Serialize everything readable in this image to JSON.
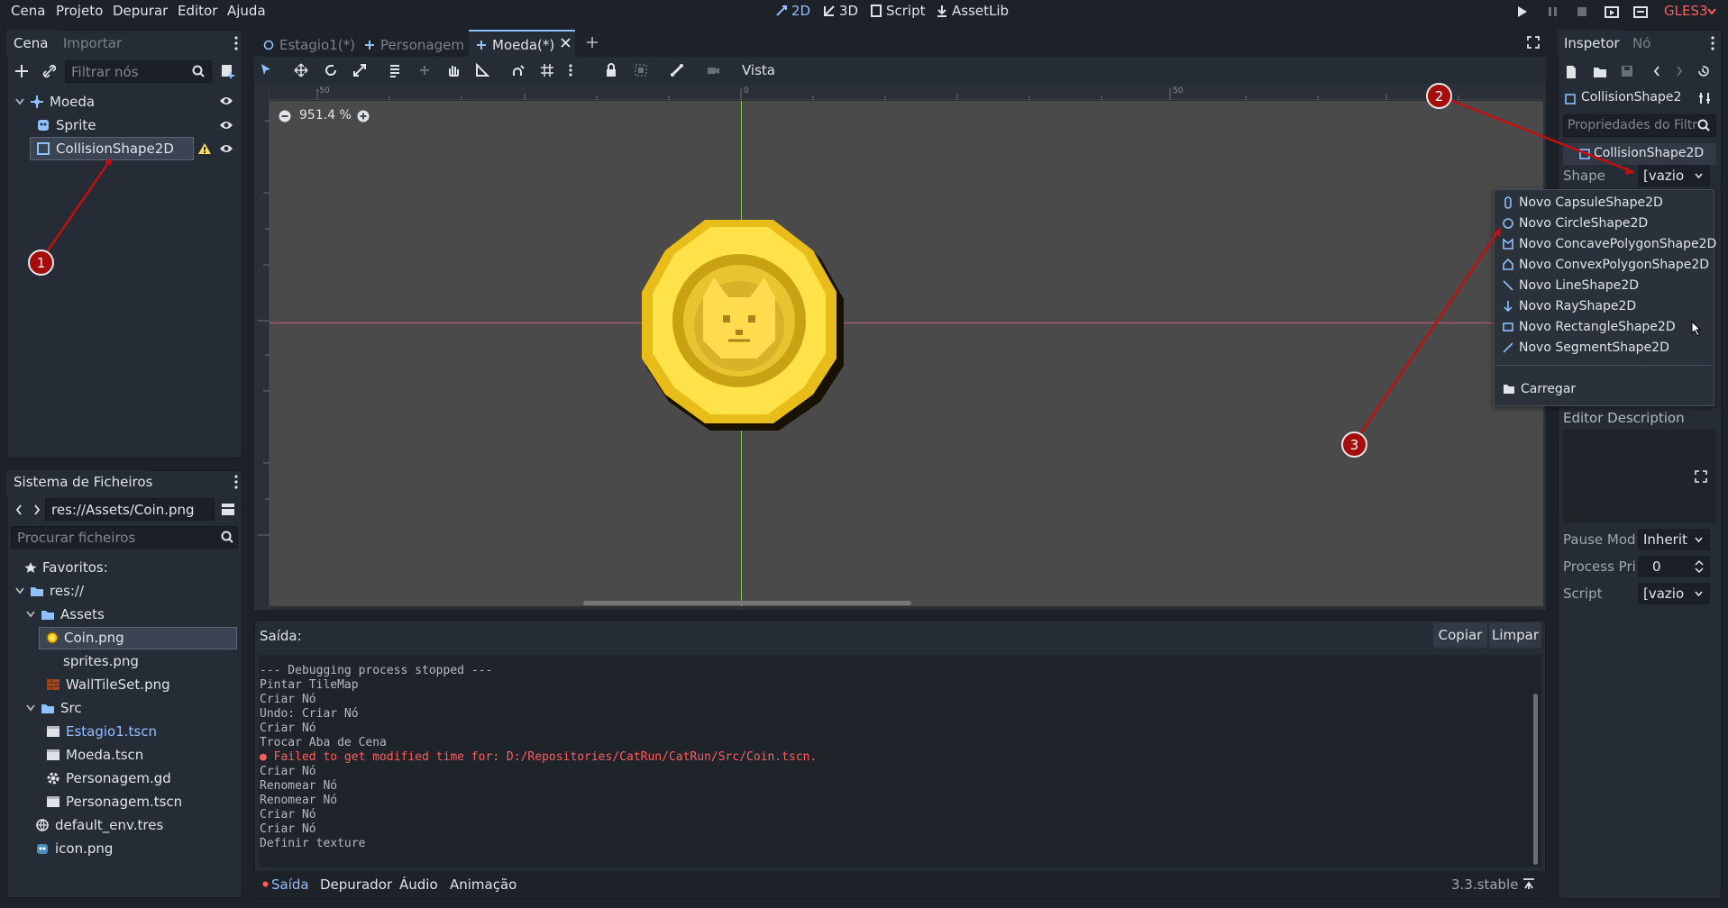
{
  "menu": {
    "items": [
      "Cena",
      "Projeto",
      "Depurar",
      "Editor",
      "Ajuda"
    ],
    "modes": [
      "2D",
      "3D",
      "Script",
      "AssetLib"
    ],
    "renderer": "GLES3"
  },
  "scene_dock": {
    "tabs": [
      "Cena",
      "Importar"
    ],
    "filter_placeholder": "Filtrar nós",
    "nodes": [
      "Moeda",
      "Sprite",
      "CollisionShape2D"
    ]
  },
  "filesystem": {
    "title": "Sistema de Ficheiros",
    "path": "res://Assets/Coin.png",
    "search_placeholder": "Procurar ficheiros",
    "favorites": "Favoritos:",
    "root": "res://",
    "items": [
      "Assets",
      "Coin.png",
      "sprites.png",
      "WallTileSet.png",
      "Src",
      "Estagio1.tscn",
      "Moeda.tscn",
      "Personagem.gd",
      "Personagem.tscn",
      "default_env.tres",
      "icon.png"
    ]
  },
  "editor_tabs": [
    "Estagio1(*)",
    "Personagem",
    "Moeda(*)"
  ],
  "toolbar": {
    "view_label": "Vista"
  },
  "viewport": {
    "zoom": "951.4 %",
    "ruler_labels": [
      "-50",
      "0",
      "50"
    ]
  },
  "output": {
    "title": "Saída:",
    "copy_label": "Copiar",
    "clear_label": "Limpar",
    "lines": [
      "--- Debugging process stopped ---",
      "Pintar TileMap",
      "Criar Nó",
      "Undo: Criar Nó",
      "Criar Nó",
      "Trocar Aba de Cena",
      "● Failed to get modified time for: D:/Repositories/CatRun/CatRun/Src/Coin.tscn.",
      "Criar Nó",
      "Renomear Nó",
      "Renomear Nó",
      "Criar Nó",
      "Criar Nó",
      "Definir texture"
    ],
    "bottom_tabs": [
      "Saída",
      "Depurador",
      "Áudio",
      "Animação"
    ],
    "version": "3.3.stable"
  },
  "inspector": {
    "tabs": [
      "Inspetor",
      "Nó"
    ],
    "object_name": "CollisionShape2",
    "filter_placeholder": "Propriedades do Filtr",
    "section": "CollisionShape2D",
    "shape_label": "Shape",
    "shape_value": "[vazio",
    "editor_description": "Editor Description",
    "pause_label": "Pause Mod",
    "pause_value": "Inherit",
    "process_label": "Process Pri",
    "process_value": "0",
    "script_label": "Script",
    "script_value": "[vazio"
  },
  "dropdown": {
    "items": [
      "Novo CapsuleShape2D",
      "Novo CircleShape2D",
      "Novo ConcavePolygonShape2D",
      "Novo ConvexPolygonShape2D",
      "Novo LineShape2D",
      "Novo RayShape2D",
      "Novo RectangleShape2D",
      "Novo SegmentShape2D"
    ],
    "load": "Carregar"
  },
  "annotations": [
    "1",
    "2",
    "3"
  ],
  "colors": {
    "accent": "#8fc0ff",
    "error": "#ff5d5d",
    "annotation": "#b00000"
  }
}
